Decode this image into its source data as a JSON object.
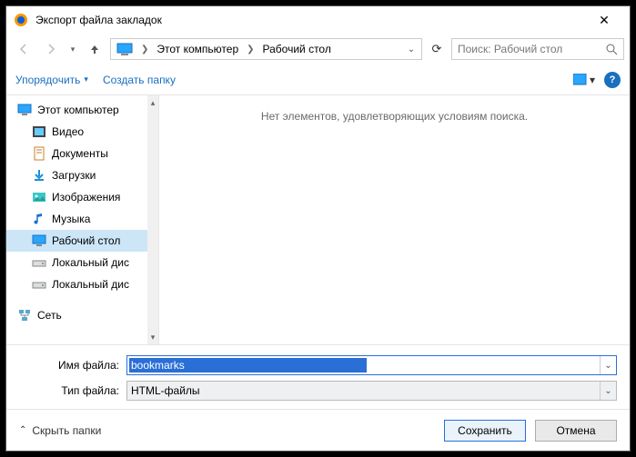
{
  "title": "Экспорт файла закладок",
  "nav": {
    "crumb1": "Этот компьютер",
    "crumb2": "Рабочий стол",
    "search_placeholder": "Поиск: Рабочий стол"
  },
  "toolbar": {
    "organize": "Упорядочить",
    "newfolder": "Создать папку"
  },
  "tree": {
    "root": "Этот компьютер",
    "items": [
      "Видео",
      "Документы",
      "Загрузки",
      "Изображения",
      "Музыка",
      "Рабочий стол",
      "Локальный дис",
      "Локальный дис"
    ],
    "network": "Сеть"
  },
  "content": {
    "empty": "Нет элементов, удовлетворяющих условиям поиска."
  },
  "form": {
    "name_label": "Имя файла:",
    "name_value": "bookmarks",
    "type_label": "Тип файла:",
    "type_value": "HTML-файлы"
  },
  "footer": {
    "hide": "Скрыть папки",
    "save": "Сохранить",
    "cancel": "Отмена"
  }
}
